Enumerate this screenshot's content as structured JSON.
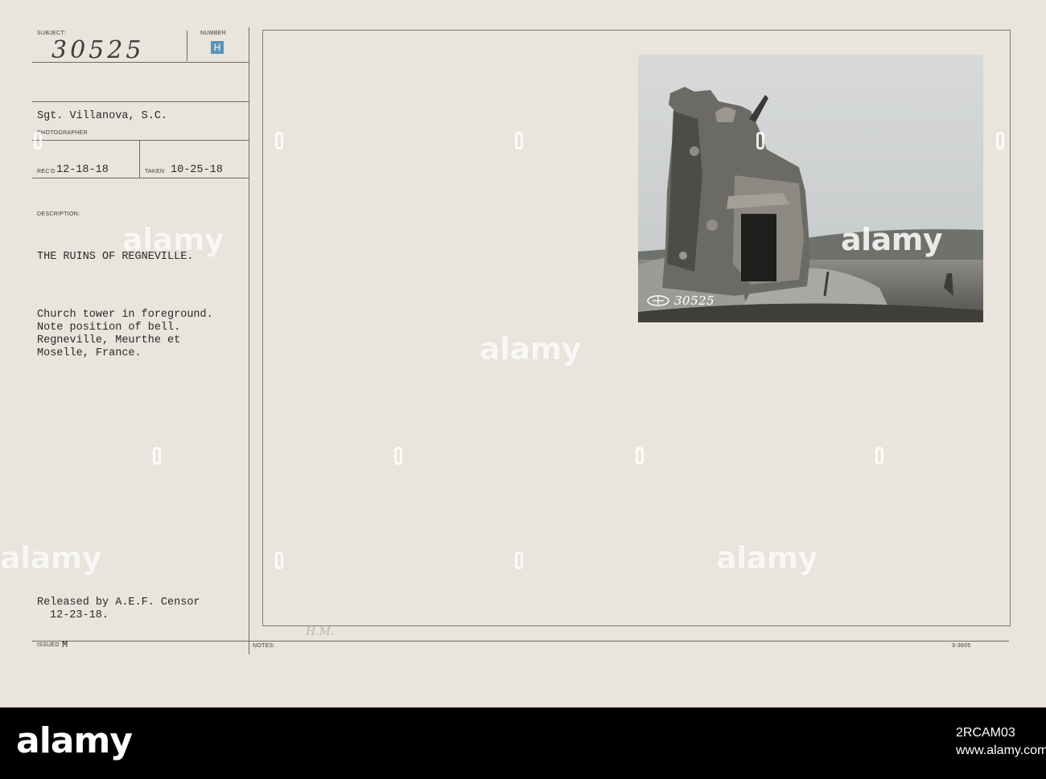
{
  "card": {
    "subject_label": "SUBJECT:",
    "subject_value": "30525",
    "number_label": "NUMBER",
    "number_value": "H",
    "photographer_name": "Sgt. Villanova, S.C.",
    "photographer_label": "PHOTOGRAPHER",
    "recd_label": "REC'D",
    "recd_value": "12-18-18",
    "taken_label": "TAKEN",
    "taken_value": "10-25-18",
    "description_label": "DESCRIPTION:",
    "description_title": "THE RUINS OF REGNEVILLE.",
    "description_lines": [
      "Church tower in foreground.",
      "Note position of bell.",
      "Regneville, Meurthe et",
      "Moselle, France."
    ],
    "released_line1": "Released by A.E.F. Censor",
    "released_line2": "12-23-18.",
    "issued_label": "ISSUED",
    "issued_value": "M",
    "notes_label": "NOTES:",
    "notes_hand": "H.M.",
    "form_code": "3-3605",
    "photo_negative_number": "30525"
  },
  "watermark": {
    "text": "alamy"
  },
  "footer": {
    "brand": "alamy",
    "image_id": "2RCAM03",
    "www": "www.alamy.com"
  }
}
